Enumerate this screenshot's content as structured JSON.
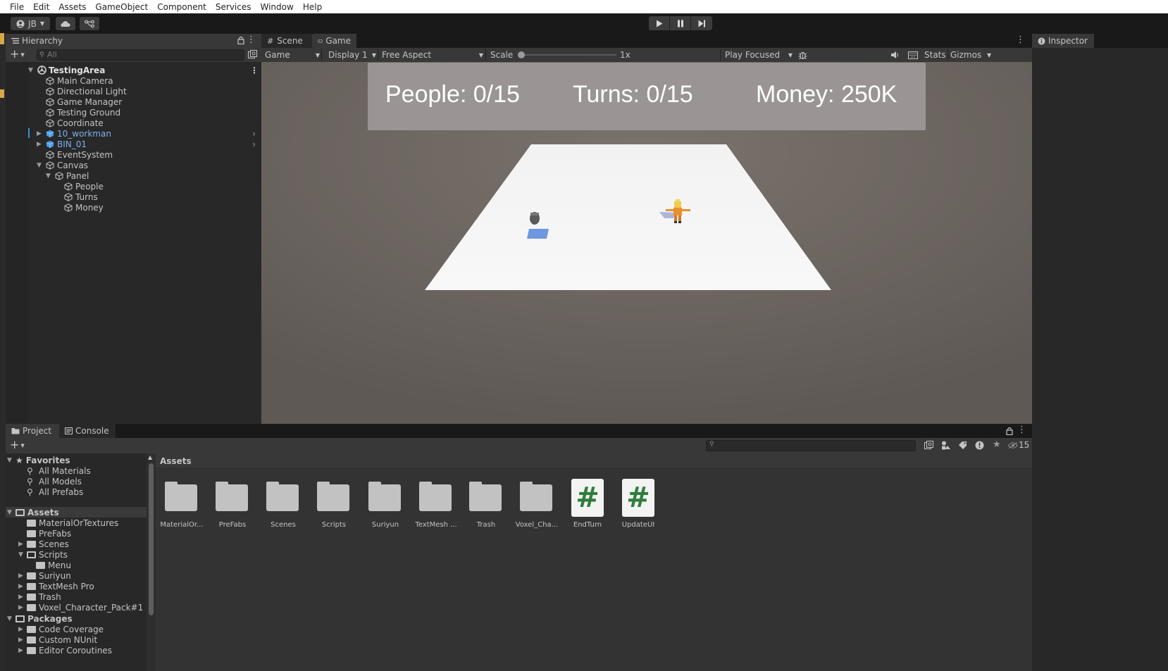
{
  "menubar": {
    "items": [
      "File",
      "Edit",
      "Assets",
      "GameObject",
      "Component",
      "Services",
      "Window",
      "Help"
    ]
  },
  "toolbar": {
    "account_label": "JB"
  },
  "hierarchy": {
    "tab_label": "Hierarchy",
    "search_placeholder": "All",
    "scene_name": "TestingArea",
    "items": [
      {
        "label": "Main Camera"
      },
      {
        "label": "Directional Light"
      },
      {
        "label": "Game Manager"
      },
      {
        "label": "Testing Ground"
      },
      {
        "label": "Coordinate"
      },
      {
        "label": "10_workman"
      },
      {
        "label": "BIN_01"
      },
      {
        "label": "EventSystem"
      },
      {
        "label": "Canvas"
      },
      {
        "label": "Panel"
      },
      {
        "label": "People"
      },
      {
        "label": "Turns"
      },
      {
        "label": "Money"
      }
    ]
  },
  "gameview": {
    "tabs": [
      "Scene",
      "Game"
    ],
    "view_select": "Game",
    "display_select": "Display 1",
    "aspect_select": "Free Aspect",
    "scale_label": "Scale",
    "scale_value": 0,
    "scale_readout": "1x",
    "play_mode_select": "Play Focused",
    "stats_label": "Stats",
    "gizmos_label": "Gizmos",
    "hud": {
      "people": "People: 0/15",
      "turns": "Turns: 0/15",
      "money": "Money: 250K"
    }
  },
  "inspector": {
    "tab_label": "Inspector"
  },
  "project": {
    "tabs": [
      "Project",
      "Console"
    ],
    "hidden_count": "15",
    "breadcrumb": "Assets",
    "tree": {
      "favorites_label": "Favorites",
      "favorites": [
        "All Materials",
        "All Models",
        "All Prefabs"
      ],
      "assets_label": "Assets",
      "assets": [
        "MaterialOrTextures",
        "PreFabs",
        "Scenes",
        "Scripts",
        "Menu",
        "Suriyun",
        "TextMesh Pro",
        "Trash",
        "Voxel_Character_Pack#1"
      ],
      "packages_label": "Packages",
      "packages": [
        "Code Coverage",
        "Custom NUnit",
        "Editor Coroutines"
      ]
    },
    "grid_items": [
      {
        "label": "MaterialOr...",
        "kind": "folder"
      },
      {
        "label": "PreFabs",
        "kind": "folder"
      },
      {
        "label": "Scenes",
        "kind": "folder"
      },
      {
        "label": "Scripts",
        "kind": "folder"
      },
      {
        "label": "Suriyun",
        "kind": "folder"
      },
      {
        "label": "TextMesh ...",
        "kind": "folder"
      },
      {
        "label": "Trash",
        "kind": "folder"
      },
      {
        "label": "Voxel_Cha...",
        "kind": "folder"
      },
      {
        "label": "EndTurn",
        "kind": "script"
      },
      {
        "label": "UpdateUI",
        "kind": "script"
      }
    ],
    "script_glyph": "#"
  },
  "colors": {
    "prefab_text": "#7cb0ee",
    "game_background": "#6b6460",
    "script_hash": "#2e7d3c"
  }
}
